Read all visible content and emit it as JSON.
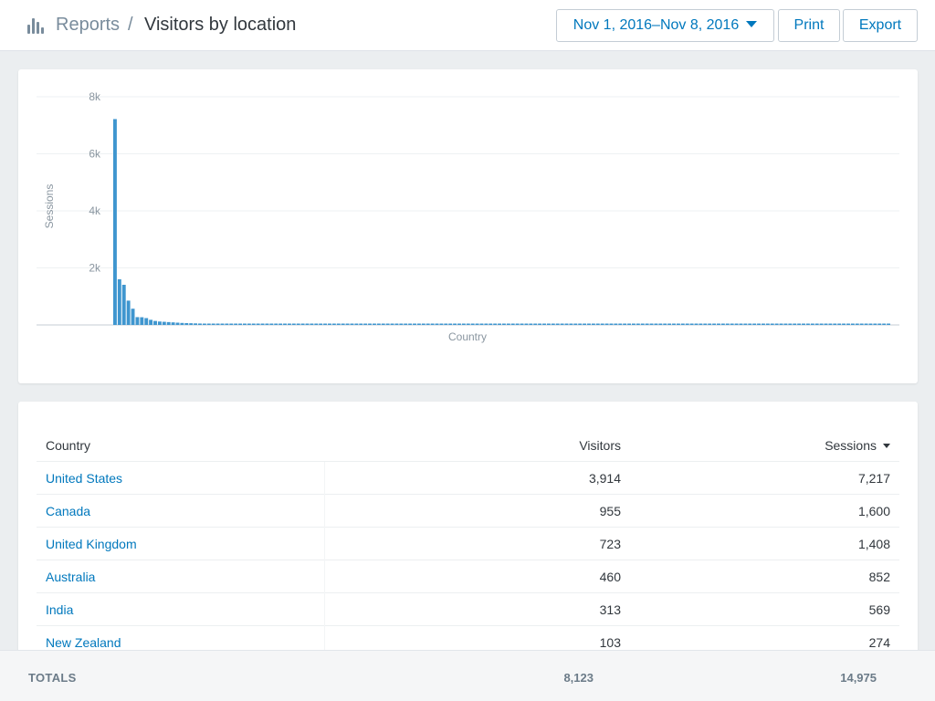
{
  "header": {
    "breadcrumb_root": "Reports",
    "breadcrumb_separator": "/",
    "title": "Visitors by location",
    "date_range": "Nov 1, 2016–Nov 8, 2016",
    "print_label": "Print",
    "export_label": "Export"
  },
  "icons": {
    "reports": "bar-chart-icon",
    "date_dropdown": "caret-down-icon",
    "sort": "caret-down-icon"
  },
  "colors": {
    "accent": "#0078bd",
    "bar": "#3f96cf",
    "muted": "#798c9c"
  },
  "chart_data": {
    "type": "bar",
    "xlabel": "Country",
    "ylabel": "Sessions",
    "ylim": [
      0,
      8000
    ],
    "yticks": [
      "2k",
      "4k",
      "6k",
      "8k"
    ],
    "grid": true,
    "series": [
      {
        "values": [
          7217,
          1600,
          1408,
          852,
          569,
          274,
          270,
          240,
          180,
          140,
          120,
          110,
          100,
          90,
          80,
          70,
          65,
          60,
          55,
          50,
          48,
          45,
          42,
          40,
          38,
          36,
          34,
          32,
          30,
          28,
          27,
          26,
          25,
          24,
          23,
          22,
          21,
          20,
          20,
          19,
          19,
          18,
          18,
          17,
          17,
          16,
          16,
          15,
          15,
          15,
          14,
          14,
          14,
          13,
          13,
          13,
          12,
          12,
          12,
          12,
          11,
          11,
          11,
          11,
          10,
          10,
          10,
          10,
          10,
          9,
          9,
          9,
          9,
          9,
          9,
          8,
          8,
          8,
          8,
          8,
          8,
          8,
          7,
          7,
          7,
          7,
          7,
          7,
          7,
          7,
          6,
          6,
          6,
          6,
          6,
          6,
          6,
          6,
          6,
          6,
          5,
          5,
          5,
          5,
          5,
          5,
          5,
          5,
          5,
          5,
          5,
          5,
          4,
          4,
          4,
          4,
          4,
          4,
          4,
          4,
          4,
          4,
          4,
          4,
          4,
          4,
          3,
          3,
          3,
          3,
          3,
          3,
          3,
          3,
          3,
          3,
          3,
          3,
          3,
          3,
          3,
          3,
          3,
          3,
          2,
          2,
          2,
          2,
          2,
          2,
          2,
          2,
          2,
          2,
          2,
          2,
          2,
          2,
          2,
          2,
          2,
          2,
          2,
          2,
          2,
          2,
          1,
          1,
          1,
          1,
          1,
          1,
          1,
          1
        ]
      }
    ]
  },
  "table": {
    "columns": [
      "Country",
      "Visitors",
      "Sessions"
    ],
    "rows": [
      {
        "country": "United States",
        "visitors": "3,914",
        "sessions": "7,217"
      },
      {
        "country": "Canada",
        "visitors": "955",
        "sessions": "1,600"
      },
      {
        "country": "United Kingdom",
        "visitors": "723",
        "sessions": "1,408"
      },
      {
        "country": "Australia",
        "visitors": "460",
        "sessions": "852"
      },
      {
        "country": "India",
        "visitors": "313",
        "sessions": "569"
      },
      {
        "country": "New Zealand",
        "visitors": "103",
        "sessions": "274"
      }
    ]
  },
  "totals": {
    "label": "TOTALS",
    "visitors": "8,123",
    "sessions": "14,975"
  }
}
